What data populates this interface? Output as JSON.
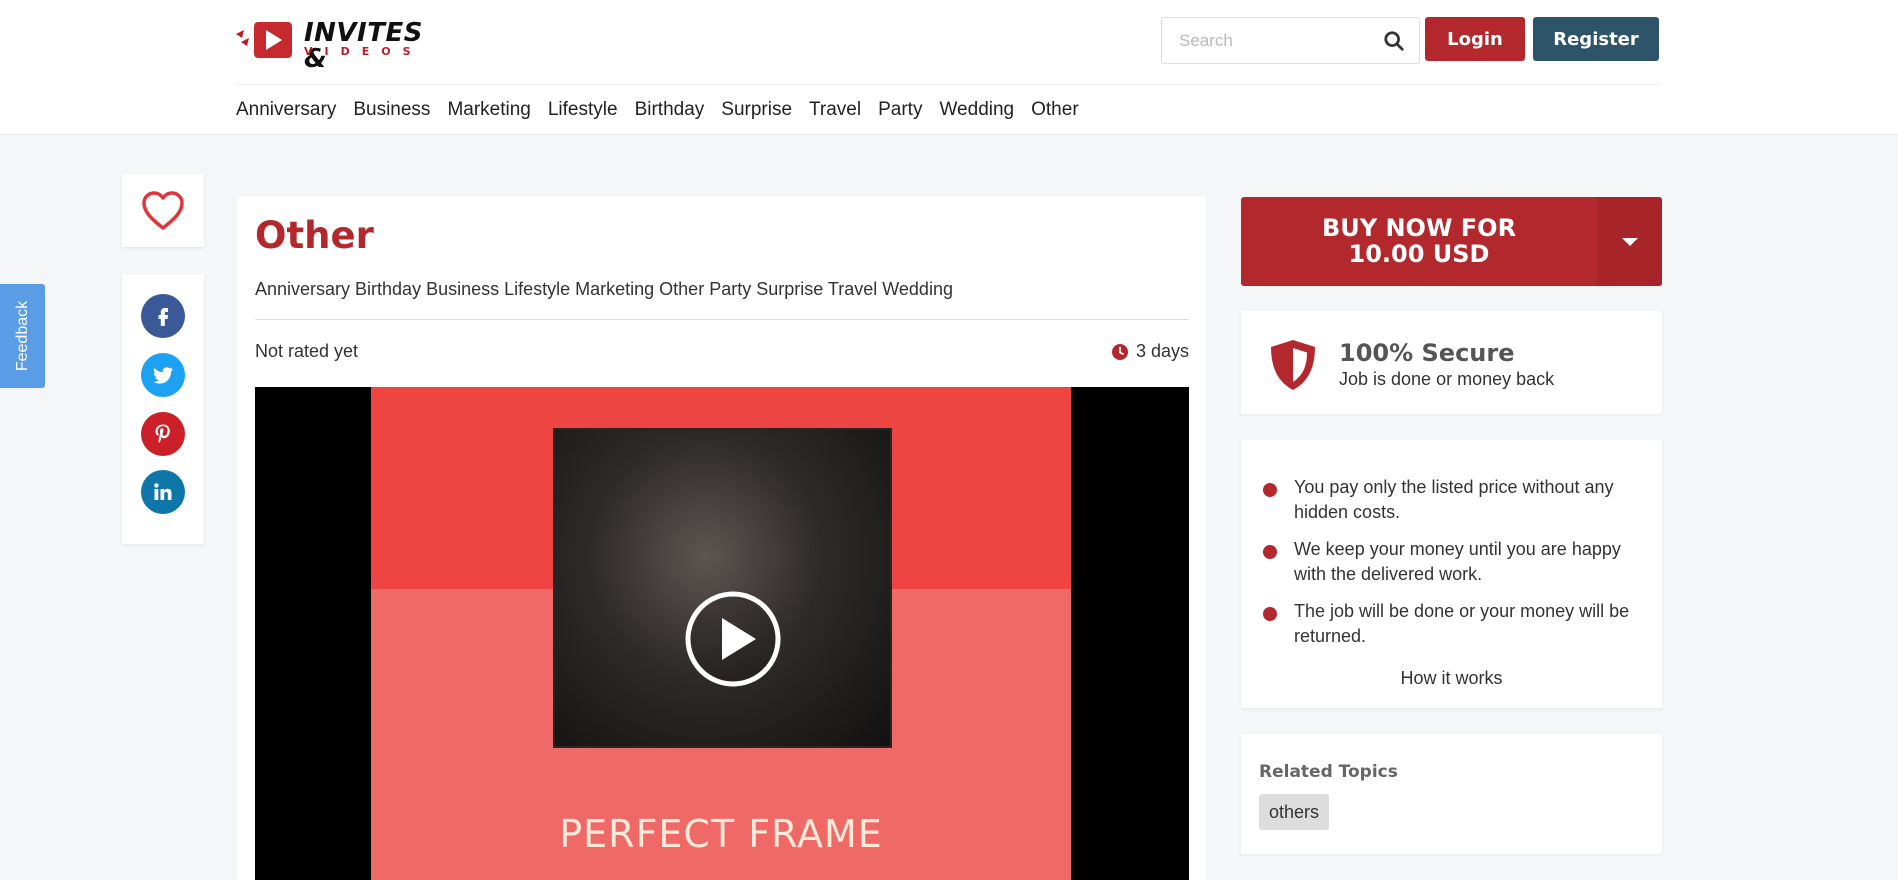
{
  "brand": {
    "name": "INVITES &",
    "sub": "VIDEOS"
  },
  "search": {
    "placeholder": "Search"
  },
  "auth": {
    "login_label": "Login",
    "register_label": "Register"
  },
  "categories": [
    "Anniversary",
    "Business",
    "Marketing",
    "Lifestyle",
    "Birthday",
    "Surprise",
    "Travel",
    "Party",
    "Wedding",
    "Other"
  ],
  "feedback": {
    "label": "Feedback"
  },
  "gig": {
    "title": "Other",
    "tags": "Anniversary Birthday Business Lifestyle Marketing Other Party Surprise Travel Wedding",
    "rating": "Not rated yet",
    "delivery": "3 days",
    "video_caption": "PERFECT FRAME"
  },
  "purchase": {
    "buy_label_line1": "BUY NOW FOR",
    "buy_label_line2": "10.00 USD"
  },
  "secure": {
    "title": "100% Secure",
    "subtitle": "Job is done or money back"
  },
  "guarantees": {
    "items": [
      "You pay only the listed price without any hidden costs.",
      "We keep your money until you are happy with the delivered work.",
      "The job will be done or your money will be returned."
    ],
    "how_link": "How it works"
  },
  "related": {
    "title": "Related Topics",
    "topics": [
      "others"
    ]
  },
  "colors": {
    "brand_red": "#b3282d",
    "register_blue": "#2d5468",
    "feedback_blue": "#5a9de6"
  },
  "icons": {
    "search": "search-icon",
    "heart": "heart-icon",
    "facebook": "facebook-icon",
    "twitter": "twitter-icon",
    "pinterest": "pinterest-icon",
    "linkedin": "linkedin-icon",
    "clock": "clock-icon",
    "play": "play-icon",
    "shield": "shield-icon",
    "caret": "caret-down-icon"
  }
}
